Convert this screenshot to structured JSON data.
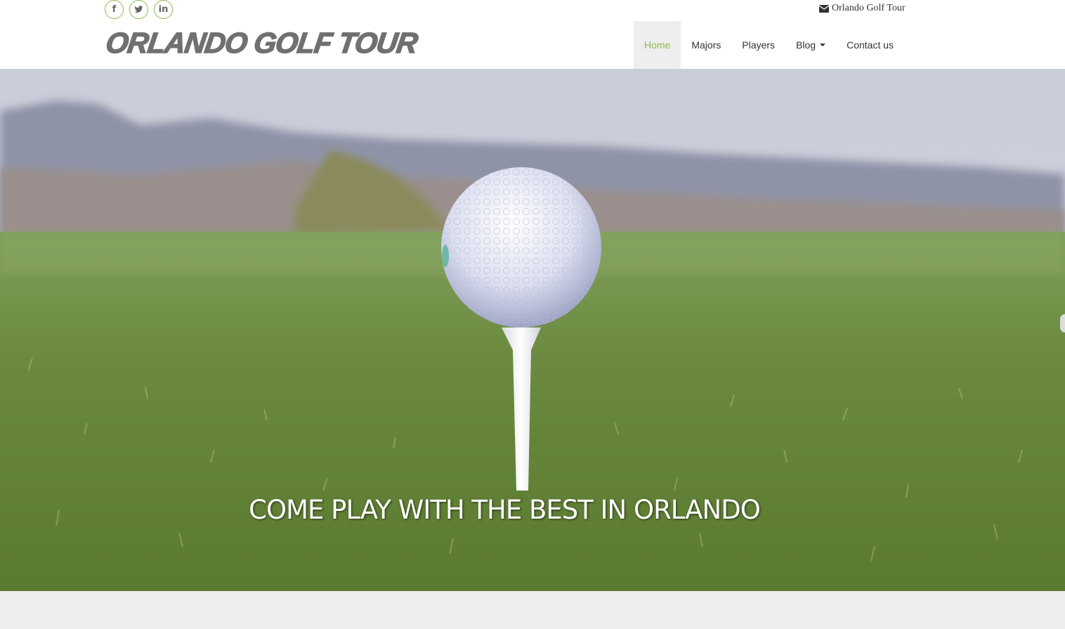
{
  "header": {
    "logo_text": "ORLANDO GOLF TOUR",
    "contact_text": "Orlando Golf Tour",
    "social": [
      {
        "icon": "facebook-icon",
        "glyph": "f"
      },
      {
        "icon": "twitter-icon"
      },
      {
        "icon": "linkedin-icon",
        "glyph": "in"
      }
    ]
  },
  "nav": {
    "items": [
      {
        "label": "Home",
        "active": true
      },
      {
        "label": "Majors"
      },
      {
        "label": "Players"
      },
      {
        "label": "Blog",
        "dropdown": true
      },
      {
        "label": "Contact us"
      }
    ]
  },
  "hero": {
    "caption": "COME PLAY WITH THE BEST IN ORLANDO"
  },
  "colors": {
    "accent": "#8bbd4b",
    "logo": "#707070",
    "nav_active_bg": "#eeeeee"
  }
}
